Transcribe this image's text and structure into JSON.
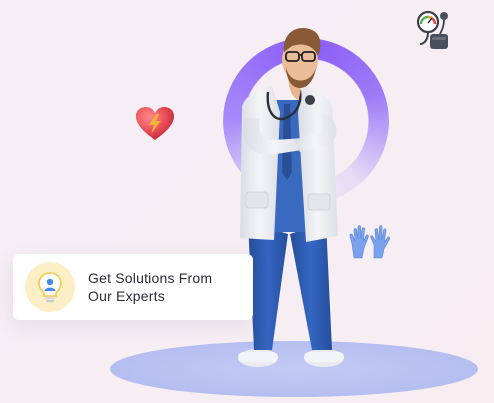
{
  "card": {
    "line1": "Get Solutions From",
    "line2": "Our Experts",
    "icon": "lightbulb-person-icon"
  },
  "illustration": {
    "subject": "doctor-figure",
    "decorations": [
      "heart-icon",
      "gloves-icon",
      "blood-pressure-monitor-icon"
    ]
  },
  "colors": {
    "ring": "#8b5cf6",
    "platform": "#b7c0f1",
    "card_icon_bg": "#fcefc5",
    "heart": "#e84a55",
    "coat": "#eef0f3",
    "scrubs": "#2f5fb3"
  }
}
